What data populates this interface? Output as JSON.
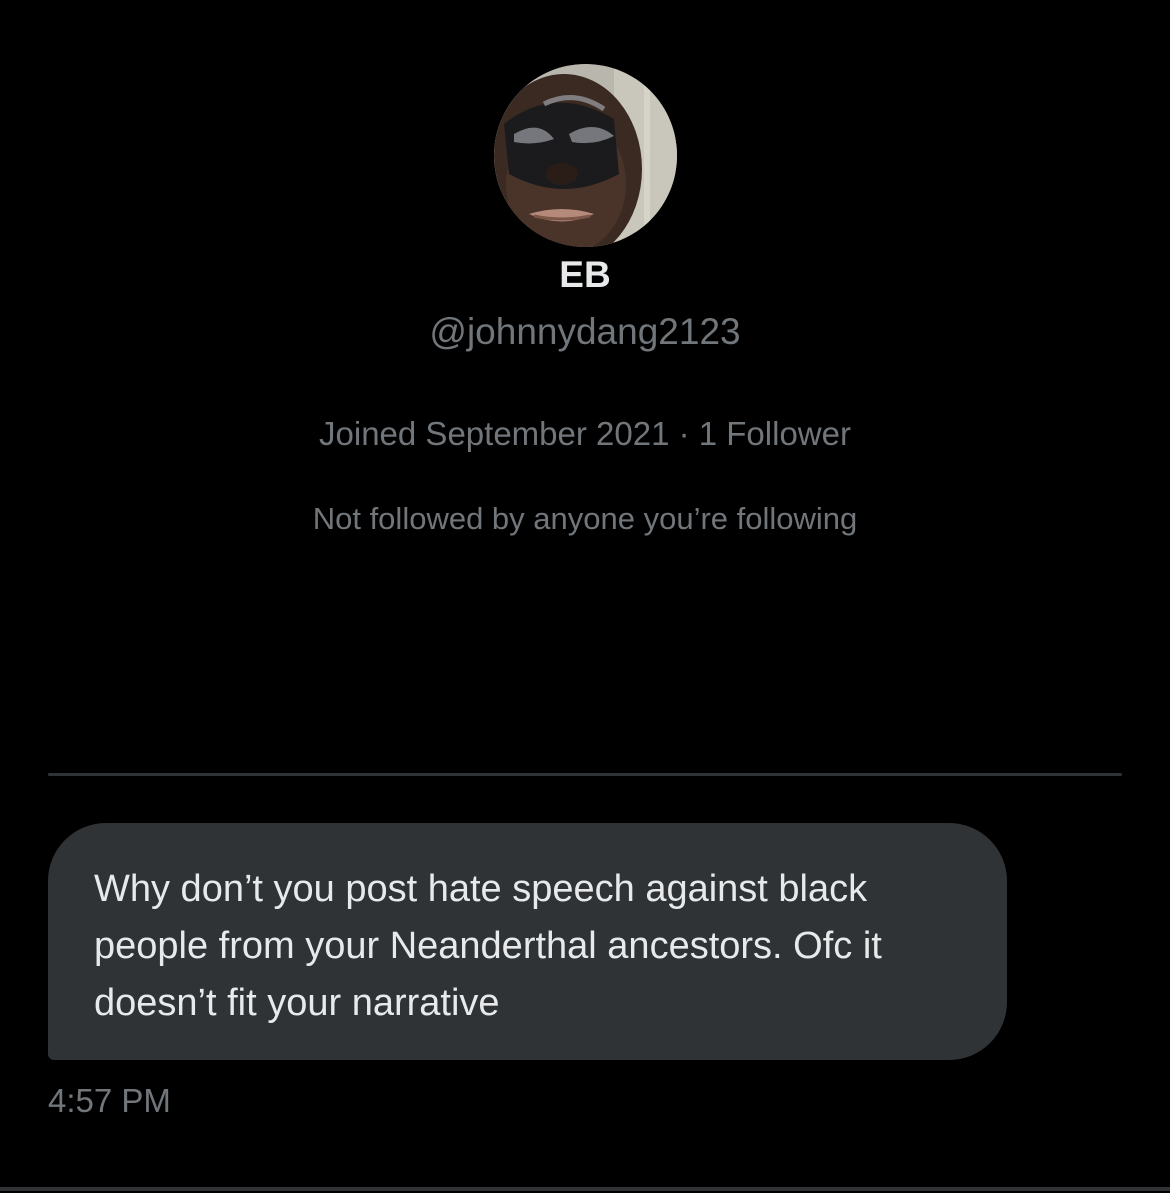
{
  "profile": {
    "display_name": "EB",
    "handle": "@johnnydang2123",
    "joined_and_followers": "Joined September 2021 · 1 Follower",
    "mutual_followers": "Not followed by anyone you’re following",
    "avatar": "profile-photo"
  },
  "conversation": {
    "messages": [
      {
        "text": "Why don’t you post hate speech against black people from your Neanderthal ancestors. Ofc it doesn’t fit your narrative",
        "time": "4:57 PM"
      }
    ]
  },
  "colors": {
    "background": "#000000",
    "primary_text": "#e7e9ea",
    "secondary_text": "#71767b",
    "bubble": "#2f3336",
    "divider": "#2f3336"
  }
}
